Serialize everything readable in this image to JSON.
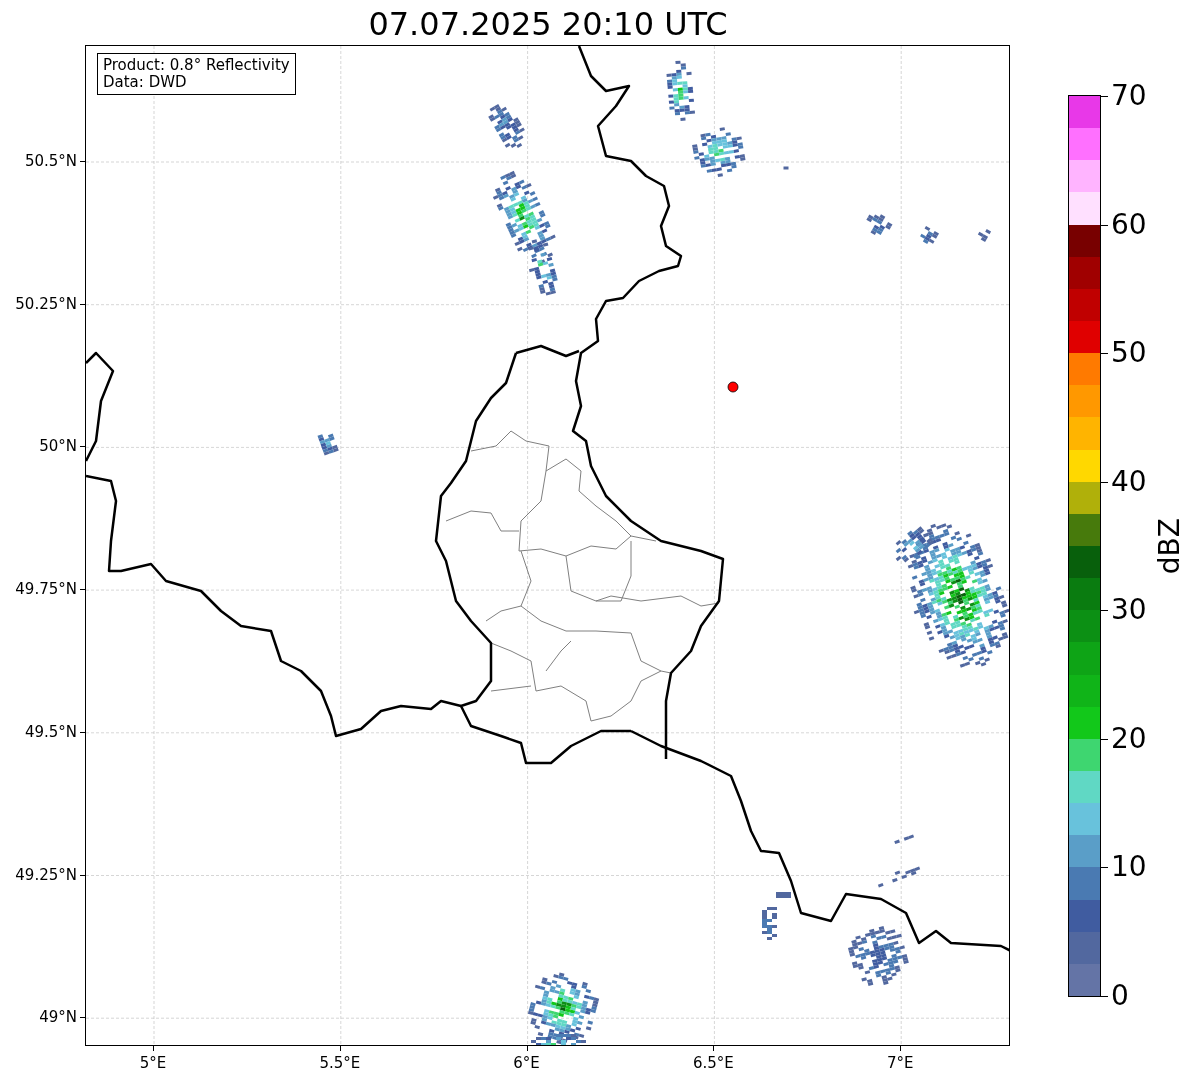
{
  "title": "07.07.2025 20:10 UTC",
  "info_box": [
    "Product: 0.8° Reflectivity",
    "Data: DWD"
  ],
  "x_ticks": [
    "5°E",
    "5.5°E",
    "6°E",
    "6.5°E",
    "7°E"
  ],
  "y_ticks": [
    "50.5°N",
    "50.25°N",
    "50°N",
    "49.75°N",
    "49.5°N",
    "49.25°N",
    "49°N"
  ],
  "colorbar": {
    "label": "dBZ",
    "ticks": [
      "70",
      "60",
      "50",
      "40",
      "30",
      "20",
      "10",
      "0"
    ],
    "bands": [
      {
        "color": "#e838e8"
      },
      {
        "color": "#ff70ff"
      },
      {
        "color": "#ffb4ff"
      },
      {
        "color": "#ffe0ff"
      },
      {
        "color": "#780000"
      },
      {
        "color": "#a00000"
      },
      {
        "color": "#c00000"
      },
      {
        "color": "#e00000"
      },
      {
        "color": "#ff7a00"
      },
      {
        "color": "#ff9800"
      },
      {
        "color": "#ffb400"
      },
      {
        "color": "#ffd800"
      },
      {
        "color": "#b0b00a"
      },
      {
        "color": "#477a0c"
      },
      {
        "color": "#08600c"
      },
      {
        "color": "#0a7c10"
      },
      {
        "color": "#0c9014"
      },
      {
        "color": "#0ea416"
      },
      {
        "color": "#10b418"
      },
      {
        "color": "#12c81a"
      },
      {
        "color": "#3ed670"
      },
      {
        "color": "#60d8c4"
      },
      {
        "color": "#68c2dc"
      },
      {
        "color": "#5a9ec8"
      },
      {
        "color": "#4a7ab2"
      },
      {
        "color": "#405ca0"
      },
      {
        "color": "#52689f"
      },
      {
        "color": "#6474a6"
      }
    ]
  }
}
